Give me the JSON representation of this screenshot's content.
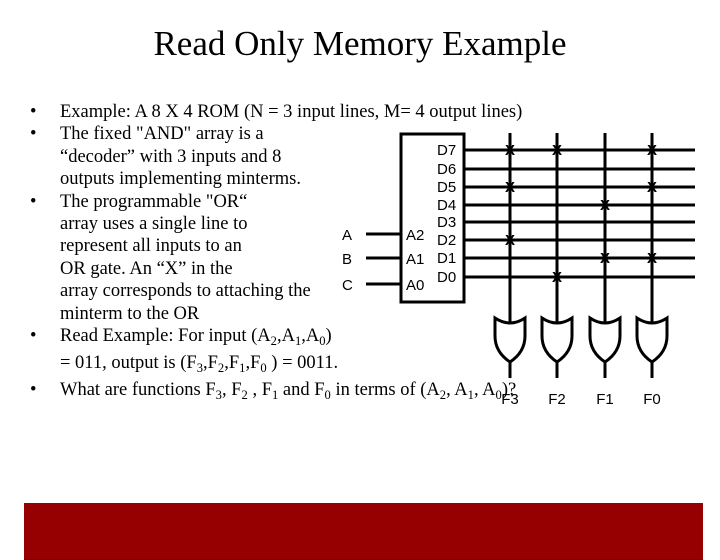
{
  "title": "Read Only Memory Example",
  "bullets": [
    {
      "lines": [
        "Example: A 8 X 4 ROM (N = 3 input lines,  M= 4 output lines)"
      ]
    },
    {
      "lines": [
        "The fixed \"AND\" array is a",
        "“decoder” with 3 inputs and 8",
        "outputs implementing minterms."
      ]
    },
    {
      "lines": [
        "The programmable \"OR“",
        "array uses a single line to",
        "represent all inputs to an",
        "OR gate.  An “X” in the",
        "array corresponds to attaching the",
        "minterm to the OR"
      ]
    },
    {
      "read_example": {
        "line1_prefix": "Read Example: For input (A",
        "line2_prefix": "= 011, output is (F",
        "line2_suffix": ") = 0011."
      }
    },
    {
      "question": {
        "prefix": "What are functions F",
        "suffix": ")?"
      }
    }
  ],
  "bullet_symbol": "•",
  "diagram": {
    "inputs": [
      "A",
      "B",
      "C"
    ],
    "decoder_inputs": [
      "A2",
      "A1",
      "A0"
    ],
    "decoder_outputs": [
      "D7",
      "D6",
      "D5",
      "D4",
      "D3",
      "D2",
      "D1",
      "D0"
    ],
    "outputs": [
      "F3",
      "F2",
      "F1",
      "F0"
    ],
    "connection_mark": "X",
    "connections": {
      "F3": [
        "D7",
        "D5",
        "D2"
      ],
      "F2": [
        "D7",
        "D0"
      ],
      "F1": [
        "D4",
        "D1"
      ],
      "F0": [
        "D7",
        "D5",
        "D1"
      ]
    }
  },
  "colors": {
    "footer_bar": "#960000",
    "ink": "#000000",
    "background": "#ffffff"
  }
}
